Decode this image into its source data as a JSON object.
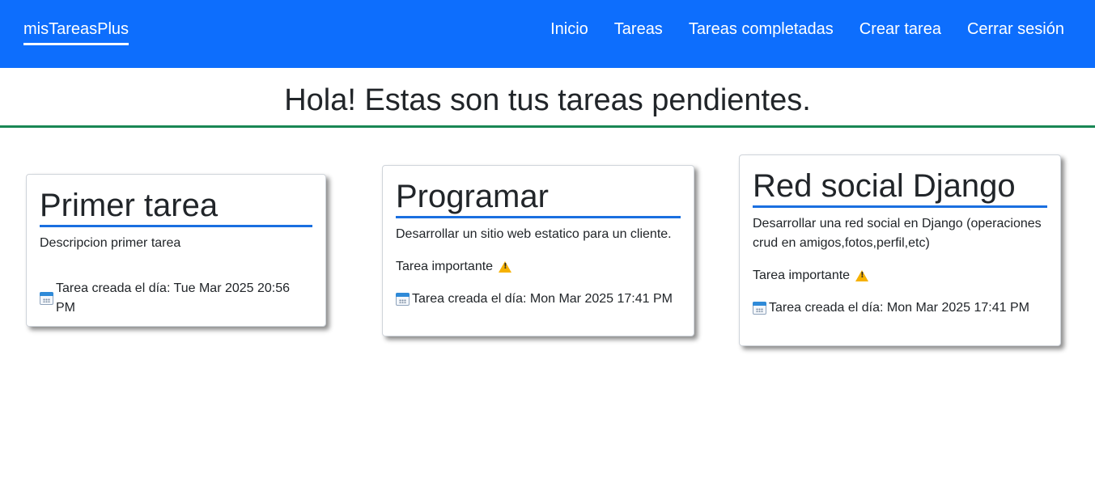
{
  "navbar": {
    "brand": "misTareasPlus",
    "links": [
      "Inicio",
      "Tareas",
      "Tareas completadas",
      "Crear tarea",
      "Cerrar sesión"
    ],
    "color": "#0d6efd"
  },
  "page": {
    "heading": "Hola! Estas son tus tareas pendientes.",
    "heading_rule_color": "#198754"
  },
  "tasks": [
    {
      "title": "Primer tarea",
      "description": "Descripcion primer tarea",
      "important_label": "",
      "important_icon": "",
      "date_icon": "calendar-icon",
      "created": "Tarea creada el día: Tue Mar 2025 20:56 PM"
    },
    {
      "title": "Programar",
      "description": "Desarrollar un sitio web estatico para un cliente.",
      "important_label": "Tarea importante",
      "important_icon": "warning-icon",
      "date_icon": "calendar-icon",
      "created": "Tarea creada el día: Mon Mar 2025 17:41 PM"
    },
    {
      "title": "Red social Django",
      "description": "Desarrollar una red social en Django (operaciones crud en amigos,fotos,perfil,etc)",
      "important_label": "Tarea importante",
      "important_icon": "warning-icon",
      "date_icon": "calendar-icon",
      "created": "Tarea creada el día: Mon Mar 2025 17:41 PM"
    }
  ]
}
